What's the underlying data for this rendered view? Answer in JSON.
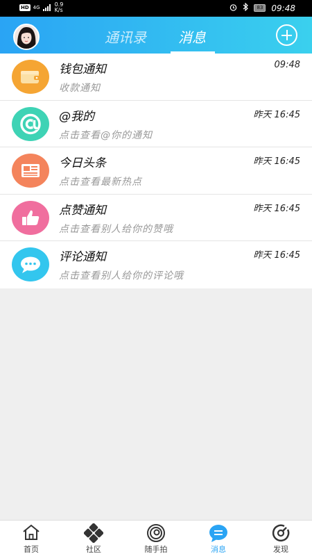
{
  "status_bar": {
    "hd": "HD",
    "network": "4G",
    "speed_value": "0.9",
    "speed_unit": "K/s",
    "battery": "83",
    "time": "09:48"
  },
  "header": {
    "tabs": [
      {
        "label": "通讯录",
        "active": false
      },
      {
        "label": "消息",
        "active": true
      }
    ],
    "accent_color": "#2aa4f4"
  },
  "messages": [
    {
      "title": "钱包通知",
      "subtitle": "收款通知",
      "time": "09:48",
      "icon": "wallet-icon",
      "color": "#f5a533"
    },
    {
      "title": "@我的",
      "subtitle": "点击查看@你的通知",
      "time": "昨天 16:45",
      "icon": "at-sign-icon",
      "color": "#3ed3b5"
    },
    {
      "title": "今日头条",
      "subtitle": "点击查看最新热点",
      "time": "昨天 16:45",
      "icon": "newspaper-icon",
      "color": "#f4845c"
    },
    {
      "title": "点赞通知",
      "subtitle": "点击查看别人给你的赞哦",
      "time": "昨天 16:45",
      "icon": "thumbs-up-icon",
      "color": "#f06e9e"
    },
    {
      "title": "评论通知",
      "subtitle": "点击查看别人给你的评论哦",
      "time": "昨天 16:45",
      "icon": "comment-bubble-icon",
      "color": "#33c6ee"
    }
  ],
  "bottom_nav": [
    {
      "label": "首页",
      "icon": "home-icon",
      "active": false
    },
    {
      "label": "社区",
      "icon": "community-icon",
      "active": false
    },
    {
      "label": "随手拍",
      "icon": "camera-swirl-icon",
      "active": false
    },
    {
      "label": "消息",
      "icon": "message-icon",
      "active": true
    },
    {
      "label": "发现",
      "icon": "discover-icon",
      "active": false
    }
  ]
}
